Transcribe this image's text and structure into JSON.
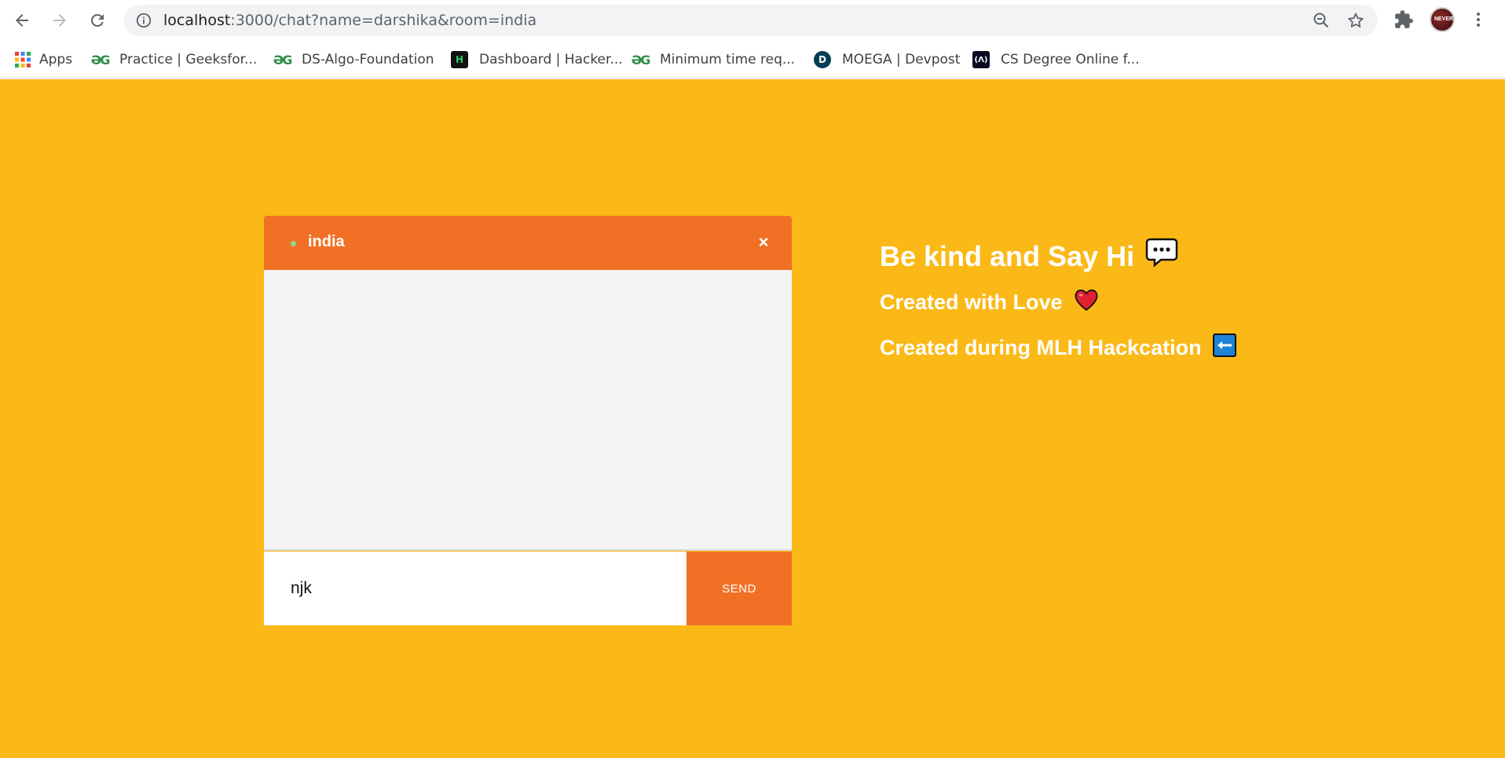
{
  "browser": {
    "url_host": "localhost",
    "url_rest": ":3000/chat?name=darshika&room=india",
    "bookmarks": [
      {
        "label": "Apps",
        "icon": "apps-grid-icon"
      },
      {
        "label": "Practice | Geeksfor...",
        "icon": "geeksforgeeks-icon"
      },
      {
        "label": "DS-Algo-Foundation",
        "icon": "geeksforgeeks-icon"
      },
      {
        "label": "Dashboard | Hacker...",
        "icon": "hackerrank-icon"
      },
      {
        "label": "Minimum time req...",
        "icon": "geeksforgeeks-icon"
      },
      {
        "label": "MOEGA | Devpost",
        "icon": "devpost-icon"
      },
      {
        "label": "CS Degree Online f...",
        "icon": "freecodecamp-icon"
      }
    ],
    "avatar_text": "NEVER"
  },
  "chat": {
    "room": "india",
    "close_label": "×",
    "input_value": "njk",
    "send_label": "SEND"
  },
  "side": {
    "line1": "Be kind and Say Hi",
    "line2": "Created with Love",
    "line3": "Created during MLH Hackcation"
  },
  "colors": {
    "page_background": "#fbb917",
    "accent": "#f07126",
    "chat_body": "#f4f4f4",
    "online_dot": "#8fdc8a"
  }
}
